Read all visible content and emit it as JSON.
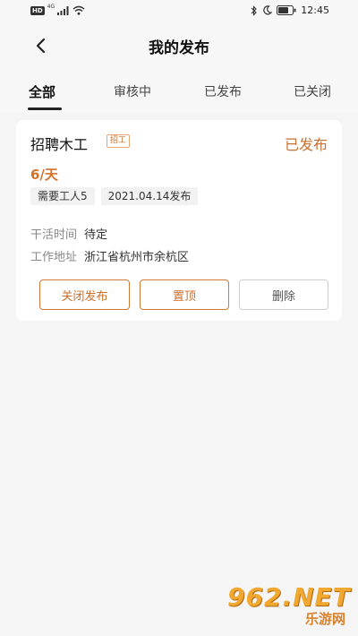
{
  "status_bar": {
    "hd": "HD",
    "network": "4G",
    "time": "12:45"
  },
  "header": {
    "title": "我的发布",
    "back_icon": "chevron-left-icon"
  },
  "tabs": [
    {
      "label": "全部",
      "active": true
    },
    {
      "label": "审核中",
      "active": false
    },
    {
      "label": "已发布",
      "active": false
    },
    {
      "label": "已关闭",
      "active": false
    }
  ],
  "job_card": {
    "title": "招聘木工",
    "tag": "招工",
    "status": "已发布",
    "salary": "6/天",
    "info_tags": [
      "需要工人5",
      "2021.04.14发布"
    ],
    "work_time_label": "干活时间",
    "work_time_value": "待定",
    "address_label": "工作地址",
    "address_value": "浙江省杭州市余杭区",
    "buttons": {
      "close": "关闭发布",
      "top": "置顶",
      "delete": "删除"
    }
  },
  "colors": {
    "accent": "#c8702e",
    "background": "#f5f5f5",
    "card": "#ffffff"
  },
  "watermark": {
    "main": "962.NET",
    "sub": "乐游网"
  }
}
